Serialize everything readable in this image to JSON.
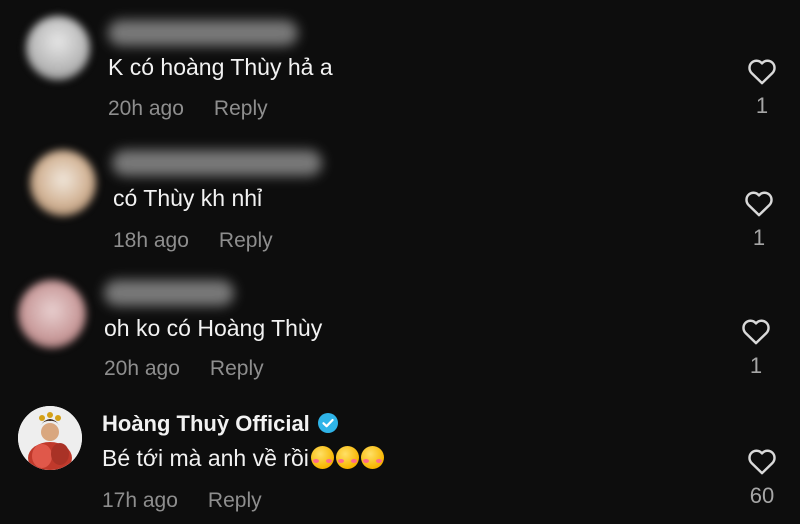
{
  "comments": [
    {
      "author": "",
      "text": "K có hoàng Thùy hả a",
      "time": "20h ago",
      "reply_label": "Reply",
      "likes": "1",
      "avatar_color": "#c9c9c9"
    },
    {
      "author": "",
      "text": "có Thùy kh nhỉ",
      "time": "18h ago",
      "reply_label": "Reply",
      "likes": "1",
      "avatar_color": "#d8c2a8"
    },
    {
      "author": "",
      "text": "oh ko có Hoàng Thùy",
      "time": "20h ago",
      "reply_label": "Reply",
      "likes": "1",
      "avatar_color": "#cfa7a7"
    },
    {
      "author": "Hoàng Thuỳ Official",
      "verified": true,
      "text": "Bé tới mà anh về rồi",
      "emojis": [
        "smiling-face-with-hearts",
        "smiling-face-with-hearts",
        "smiling-face-with-hearts"
      ],
      "time": "17h ago",
      "reply_label": "Reply",
      "likes": "60",
      "avatar_color": "#c0392b"
    }
  ],
  "colors": {
    "background": "#0d0d0d",
    "text": "#f2f2f2",
    "meta": "#8e8e8e",
    "verified": "#2fb4e8"
  }
}
